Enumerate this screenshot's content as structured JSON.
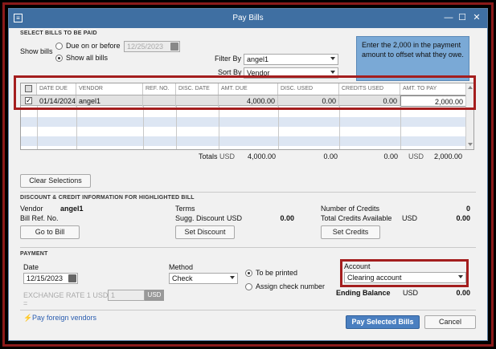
{
  "window": {
    "title": "Pay Bills",
    "sys_icon": "≡",
    "min": "—",
    "max": "☐",
    "close": "✕"
  },
  "select_bills": {
    "section_label": "SELECT BILLS TO BE PAID",
    "show_bills_label": "Show bills",
    "radio_due_label": "Due on or before",
    "radio_due_date": "12/25/2023",
    "radio_all_label": "Show all bills",
    "filter_by_label": "Filter By",
    "filter_by_value": "angel1",
    "sort_by_label": "Sort By",
    "sort_by_value": "Vendor",
    "tip_text": "Enter the 2,000 in the payment amount to offset what they owe."
  },
  "grid": {
    "columns": [
      "DATE DUE",
      "VENDOR",
      "REF. NO.",
      "DISC. DATE",
      "AMT. DUE",
      "DISC. USED",
      "CREDITS USED",
      "AMT. TO PAY"
    ],
    "row": {
      "checked": "✓",
      "date_due": "01/14/2024",
      "vendor": "angel1",
      "ref_no": "",
      "disc_date": "",
      "amt_due": "4,000.00",
      "disc_used": "0.00",
      "credits_used": "0.00",
      "amt_to_pay": "2,000.00"
    },
    "totals": {
      "label": "Totals",
      "currency": "USD",
      "amt_due": "4,000.00",
      "disc_used": "0.00",
      "credits_used": "0.00",
      "currency2": "USD",
      "amt_to_pay": "2,000.00"
    }
  },
  "clear_selections": "Clear Selections",
  "discount": {
    "section_label": "DISCOUNT & CREDIT INFORMATION FOR HIGHLIGHTED BILL",
    "vendor_label": "Vendor",
    "vendor_value": "angel1",
    "bill_ref_label": "Bill Ref. No.",
    "terms_label": "Terms",
    "sugg_discount_label": "Sugg. Discount",
    "sugg_discount_currency": "USD",
    "sugg_discount_value": "0.00",
    "num_credits_label": "Number of Credits",
    "num_credits_value": "0",
    "total_credits_label": "Total Credits Available",
    "total_credits_currency": "USD",
    "total_credits_value": "0.00",
    "go_to_bill": "Go to Bill",
    "set_discount": "Set Discount",
    "set_credits": "Set Credits"
  },
  "payment": {
    "section_label": "PAYMENT",
    "date_label": "Date",
    "date_value": "12/15/2023",
    "exchange_label": "EXCHANGE RATE 1 USD",
    "exchange_eq": "=",
    "exchange_value": "1",
    "exchange_currency": "USD",
    "method_label": "Method",
    "method_value": "Check",
    "to_be_printed": "To be printed",
    "assign_check": "Assign check number",
    "account_label": "Account",
    "account_value": "Clearing account",
    "ending_balance_label": "Ending Balance",
    "ending_balance_currency": "USD",
    "ending_balance_value": "0.00"
  },
  "footer": {
    "foreign_icon": "⚡",
    "pay_foreign": "Pay foreign vendors",
    "pay_selected": "Pay Selected Bills",
    "cancel": "Cancel"
  },
  "colors": {
    "titlebar": "#3f6fa2",
    "highlight": "#a41e1e",
    "tip": "#7aa9d6",
    "primary_button": "#4a7fc0",
    "row_stripe": "#dde6f3"
  }
}
